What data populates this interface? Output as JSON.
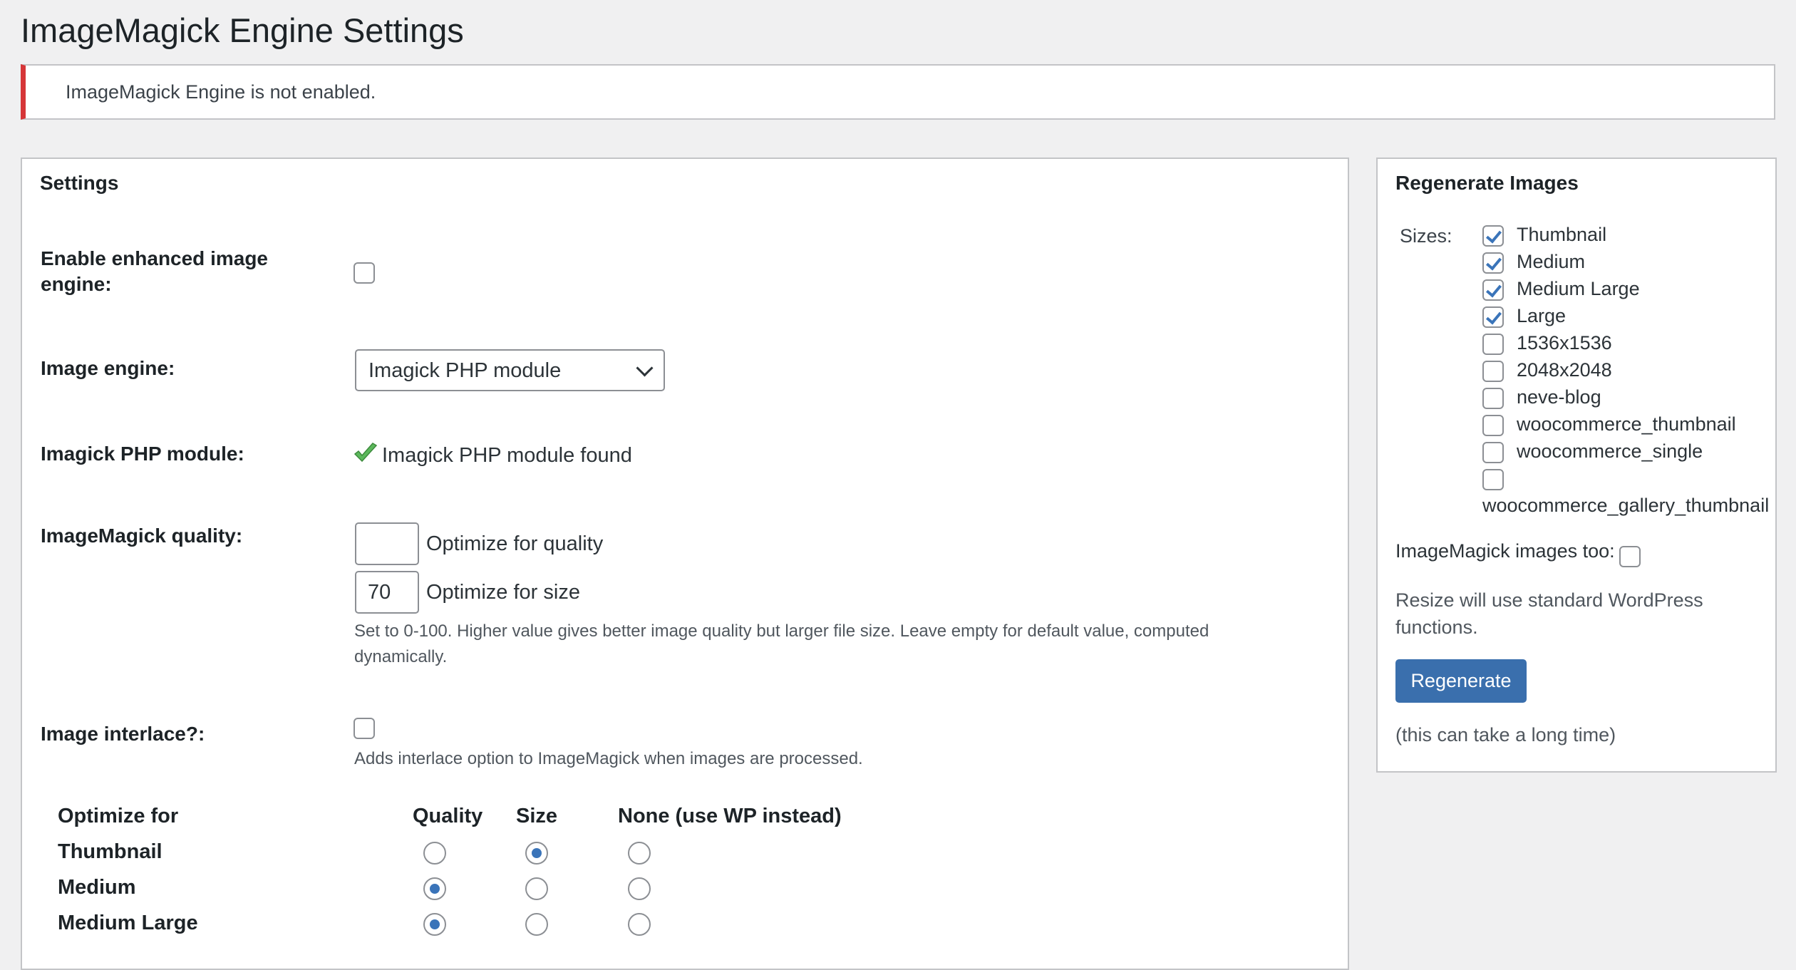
{
  "page_title": "ImageMagick Engine Settings",
  "notice": {
    "text": "ImageMagick Engine is not enabled.",
    "type": "error",
    "color": "#d63638"
  },
  "settings": {
    "title": "Settings",
    "enable_label": "Enable enhanced image engine:",
    "enable_checked": false,
    "engine_label": "Image engine:",
    "engine_value": "Imagick PHP module",
    "module_label": "Imagick PHP module:",
    "module_status": "Imagick PHP module found",
    "quality_label": "ImageMagick quality:",
    "quality_value": "",
    "quality_hint": "Optimize for quality",
    "size_value": "70",
    "size_hint": "Optimize for size",
    "quality_desc": "Set to 0-100. Higher value gives better image quality but larger file size. Leave empty for default value, computed dynamically.",
    "interlace_label": "Image interlace?:",
    "interlace_checked": false,
    "interlace_desc": "Adds interlace option to ImageMagick when images are processed.",
    "optimize_table": {
      "headers": [
        "Optimize for",
        "Quality",
        "Size",
        "None (use WP instead)"
      ],
      "rows": [
        {
          "label": "Thumbnail",
          "selected": "Size"
        },
        {
          "label": "Medium",
          "selected": "Quality"
        },
        {
          "label": "Medium Large",
          "selected": "Quality"
        }
      ]
    }
  },
  "regenerate": {
    "title": "Regenerate Images",
    "sizes_label": "Sizes:",
    "sizes": [
      {
        "label": "Thumbnail",
        "checked": true
      },
      {
        "label": "Medium",
        "checked": true
      },
      {
        "label": "Medium Large",
        "checked": true
      },
      {
        "label": "Large",
        "checked": true
      },
      {
        "label": "1536x1536",
        "checked": false
      },
      {
        "label": "2048x2048",
        "checked": false
      },
      {
        "label": "neve-blog",
        "checked": false
      },
      {
        "label": "woocommerce_thumbnail",
        "checked": false
      },
      {
        "label": "woocommerce_single",
        "checked": false
      },
      {
        "label": "woocommerce_gallery_thumbnail",
        "checked": false
      }
    ],
    "im_too_label": "ImageMagick images too:",
    "im_too_checked": false,
    "resize_note": "Resize will use standard WordPress functions.",
    "button_label": "Regenerate",
    "button_color": "#3a6fad",
    "time_note": "(this can take a long time)"
  }
}
